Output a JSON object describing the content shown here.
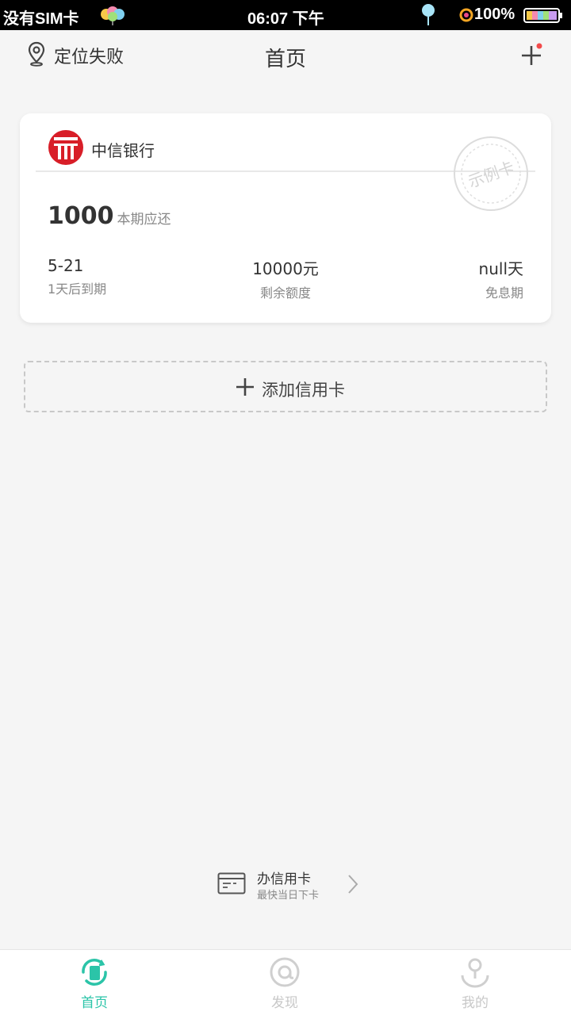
{
  "status_bar": {
    "carrier": "没有SIM卡",
    "time": "06:07 下午",
    "battery": "100%"
  },
  "header": {
    "location": "定位失败",
    "title": "首页"
  },
  "card": {
    "bank_name": "中信银行",
    "stamp": "示例卡",
    "amount": "1000",
    "amount_label": "本期应还",
    "due_date": "5-21",
    "due_label": "1天后到期",
    "credit_remaining": "10000元",
    "credit_label": "剩余额度",
    "free_days": "null天",
    "free_label": "免息期"
  },
  "add_card": {
    "label": "添加信用卡"
  },
  "apply": {
    "title": "办信用卡",
    "subtitle": "最快当日下卡"
  },
  "nav": {
    "home": "首页",
    "discover": "发现",
    "mine": "我的"
  },
  "colors": {
    "accent": "#2bc4a8",
    "bank_red": "#d81e28",
    "badge_red": "#f24b4b"
  }
}
